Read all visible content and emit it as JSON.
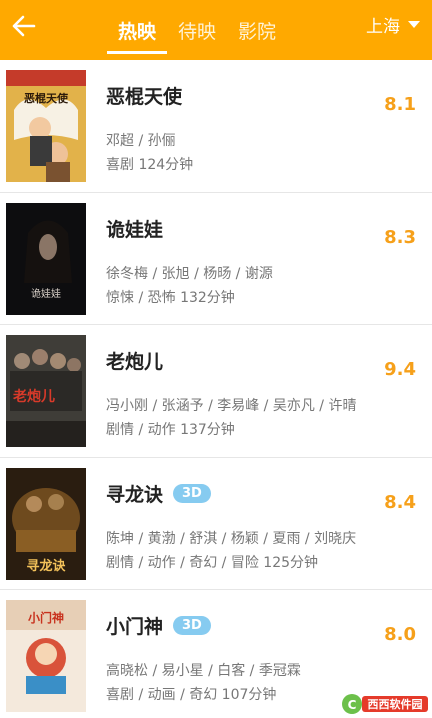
{
  "header": {
    "tabs": [
      {
        "label": "热映",
        "active": true
      },
      {
        "label": "待映",
        "active": false
      },
      {
        "label": "影院",
        "active": false
      }
    ],
    "city": "上海",
    "accent": "#ffa900"
  },
  "movies": [
    {
      "title": "恶棍天使",
      "badge": "",
      "cast": "邓超 / 孙俪",
      "genre": "喜剧  124分钟",
      "rating": "8.1",
      "poster_text": "恶棍天使"
    },
    {
      "title": "诡娃娃",
      "badge": "",
      "cast": "徐冬梅 / 张旭 / 杨旸 / 谢源",
      "genre": "惊悚 / 恐怖  132分钟",
      "rating": "8.3",
      "poster_text": "诡娃娃"
    },
    {
      "title": "老炮儿",
      "badge": "",
      "cast": "冯小刚 / 张涵予 / 李易峰 / 吴亦凡 / 许晴",
      "genre": "剧情 / 动作  137分钟",
      "rating": "9.4",
      "poster_text": "老炮儿"
    },
    {
      "title": "寻龙诀",
      "badge": "3D",
      "cast": "陈坤 / 黄渤 / 舒淇 / 杨颖 / 夏雨 / 刘晓庆",
      "genre": "剧情 / 动作 / 奇幻 / 冒险  125分钟",
      "rating": "8.4",
      "poster_text": "寻龙诀"
    },
    {
      "title": "小门神",
      "badge": "3D",
      "cast": "高晓松 / 易小星 / 白客 / 季冠霖",
      "genre": "喜剧 / 动画 / 奇幻  107分钟",
      "rating": "8.0",
      "poster_text": "小门神"
    }
  ],
  "watermark": {
    "text": "西西软件园"
  }
}
